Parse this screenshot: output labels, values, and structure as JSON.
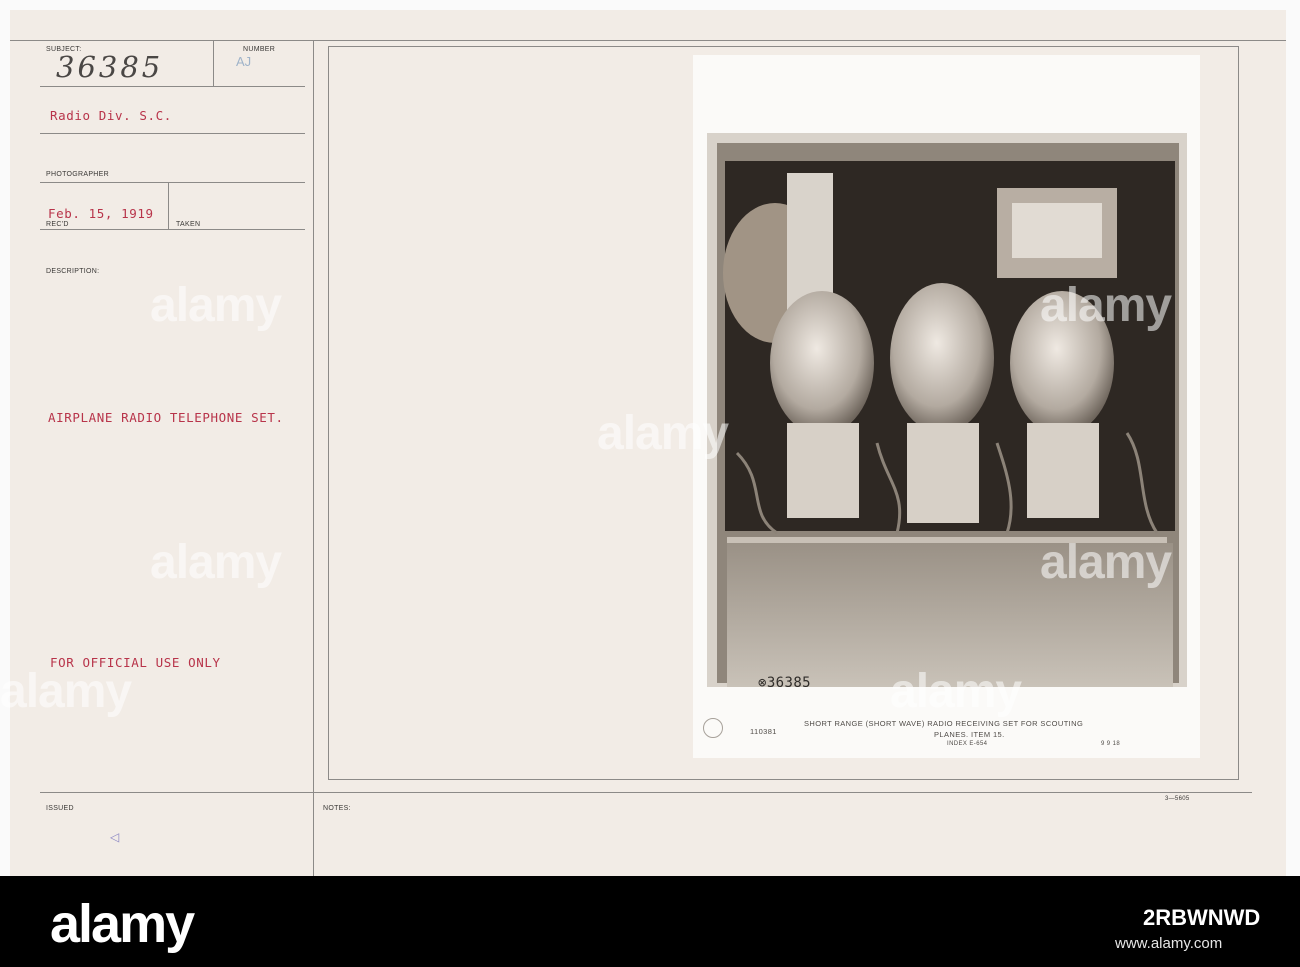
{
  "card": {
    "subject_label": "SUBJECT:",
    "subject_number": "36385",
    "number_label": "NUMBER",
    "number_stamp": "AJ",
    "origin": "Radio Div. S.C.",
    "photographer_label": "PHOTOGRAPHER",
    "date": "Feb. 15, 1919",
    "recd_label": "REC'D",
    "taken_label": "TAKEN",
    "description_label": "DESCRIPTION:",
    "description": "AIRPLANE RADIO TELEPHONE SET.",
    "restriction": "FOR OFFICIAL USE ONLY",
    "issued_label": "ISSUED",
    "issued_mark": "◁",
    "notes_label": "NOTES:",
    "form_code": "3—5605"
  },
  "photo": {
    "negative_number": "⊗36385",
    "caption_number": "110381",
    "caption_line1": "SHORT RANGE (SHORT WAVE) RADIO RECEIVING SET FOR SCOUTING",
    "caption_line2": "PLANES. ITEM 15.",
    "index": "INDEX E-654",
    "caption_date": "9  9  18"
  },
  "watermark": {
    "text": "alamy"
  },
  "footer": {
    "logo": "alamy",
    "image_id": "2RBWNWD",
    "url": "www.alamy.com"
  }
}
